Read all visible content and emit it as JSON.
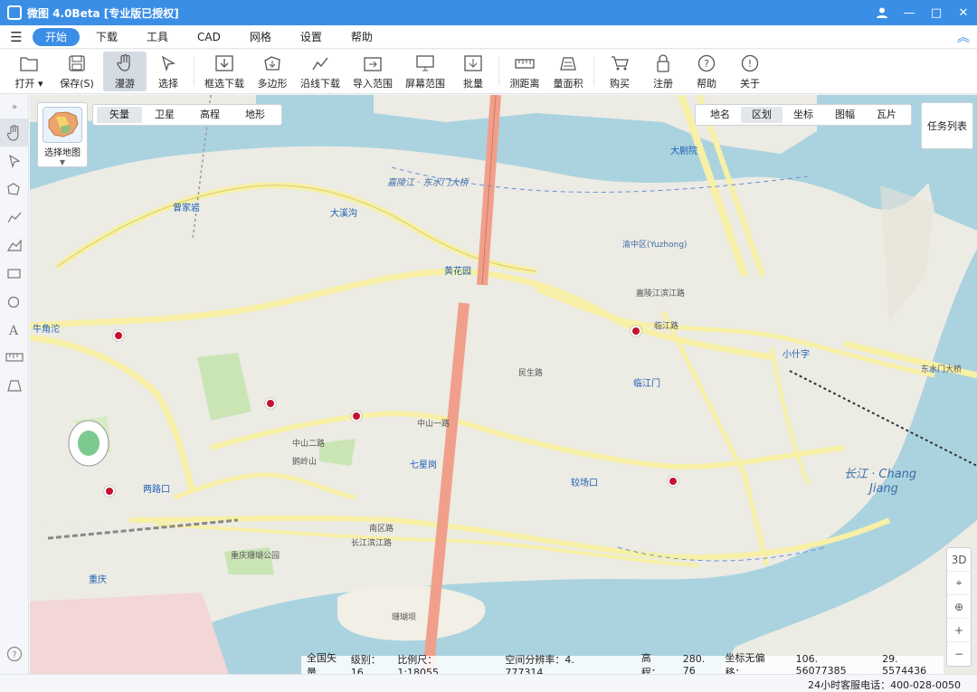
{
  "title": {
    "app": "微图 4.0Beta [专业版已授权]"
  },
  "menu": {
    "items": [
      "开始",
      "下载",
      "工具",
      "CAD",
      "网格",
      "设置",
      "帮助"
    ],
    "active_index": 0
  },
  "toolbar": {
    "open": "打开",
    "save": "保存(S)",
    "pan": "漫游",
    "select": "选择",
    "box_download": "框选下载",
    "polygon": "多边形",
    "route_download": "沿线下载",
    "import_range": "导入范围",
    "screen_range": "屏幕范围",
    "batch": "批量",
    "measure_distance": "测距离",
    "measure_area": "量面积",
    "buy": "购买",
    "register": "注册",
    "help": "帮助",
    "about": "关于"
  },
  "map": {
    "picker_label": "选择地图",
    "layer_tabs": [
      "矢量",
      "卫星",
      "高程",
      "地形"
    ],
    "active_layer": "矢量",
    "overlay_tabs": [
      "地名",
      "区划",
      "坐标",
      "图幅",
      "瓦片"
    ],
    "active_overlay": "区划",
    "task_list": "任务列表",
    "zoom_controls": [
      "3D",
      "⌖",
      "⊕",
      "+",
      "−"
    ],
    "labels": {
      "river_jialing": "嘉陵江 · 东水门大桥",
      "river_changjiang_line1": "长江 · Chang",
      "river_changjiang_line2": "Jiang",
      "dadaohu": "大溪沟",
      "huanghuayuan": "黄花园",
      "linjiangmen": "临江门",
      "qixinggang": "七星岗",
      "jiaochangkou": "较场口",
      "lianglukou": "两路口",
      "chongqing": "重庆",
      "xiaoshizi": "小什字",
      "dajuyuan": "大剧院",
      "zengjiayan": "曾家岩",
      "niujiaotuo": "牛角沱",
      "eling": "鹅岭山",
      "zhonghuanroad": "中山一路",
      "zhongshan2": "中山二路",
      "jialingbin": "嘉陵江滨江路",
      "changjiangbin": "长江滨江路",
      "nanqu": "南区路",
      "chongqing_park": "重庆珊瑚公园",
      "shanhuba": "珊瑚坝",
      "dongshuimen": "东水门大桥",
      "lingjiang": "临江路",
      "minzu": "民生路",
      "yuzhong": "渝中区(Yuzhong)"
    }
  },
  "status": {
    "source": "全国矢量",
    "level": "级别：16",
    "scale": "比例尺：1:18055",
    "resolution": "空间分辨率：4. 777314",
    "elevation_label": "高程：",
    "elevation": "280. 76",
    "offset": "坐标无偏移：",
    "lon": "106. 56077385",
    "lat": "29. 5574436"
  },
  "footer": {
    "hotline": "24小时客服电话：400-028-0050"
  },
  "colors": {
    "title_bar": "#3a8ee6",
    "river": "#aad3df",
    "land": "#ecebe4",
    "road_major": "#f7f0a6",
    "bridge": "#f0a08a"
  }
}
